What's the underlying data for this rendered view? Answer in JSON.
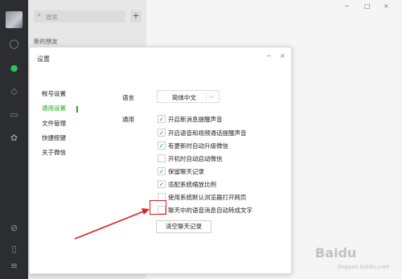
{
  "sessions": {
    "search_placeholder": "搜索",
    "add_label": "+",
    "section_new_friends": "新的朋友"
  },
  "window_controls": [
    "−",
    "□",
    "×"
  ],
  "dialog": {
    "title": "设置",
    "minimize": "−",
    "close": "×",
    "nav": [
      "帐号设置",
      "通用设置",
      "文件管理",
      "快捷按键",
      "关于微信"
    ],
    "nav_active_index": 1,
    "language_label": "语言",
    "language_value": "简体中文",
    "general_label": "通用",
    "options": [
      {
        "label": "开启新消息提醒声音",
        "checked": true
      },
      {
        "label": "开启语音和视频通话提醒声音",
        "checked": true
      },
      {
        "label": "有更新时自动升级微信",
        "checked": true
      },
      {
        "label": "开机时自动启动微信",
        "checked": false
      },
      {
        "label": "保留聊天记录",
        "checked": true
      },
      {
        "label": "适配系统缩放比例",
        "checked": true
      },
      {
        "label": "使用系统默认浏览器打开网页",
        "checked": false
      },
      {
        "label": "聊天中的语音消息自动转成文字",
        "checked": false
      }
    ],
    "clear_button": "清空聊天记录"
  },
  "watermark": {
    "line1": "Baidu",
    "line2": "jingyan.baidu.com"
  },
  "colors": {
    "accent": "#1aad19",
    "highlight": "#e02020",
    "rail": "#2b2d31"
  }
}
